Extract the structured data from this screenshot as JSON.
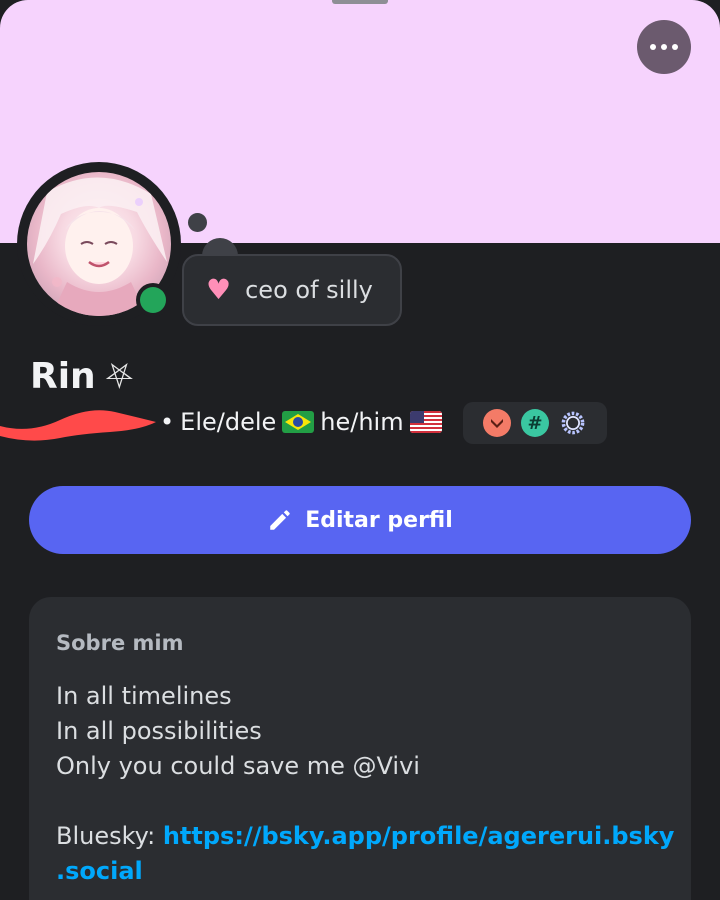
{
  "profile": {
    "display_name": "Rin",
    "name_symbol": "⛧",
    "pronouns_separator": "•",
    "pronouns_pt": "Ele/dele",
    "pronouns_en": "he/him"
  },
  "status": {
    "emoji": "♥",
    "text": "ceo of silly",
    "online_indicator": "online"
  },
  "badges": [
    "hypesquad-icon",
    "hashtag-icon",
    "wreath-icon"
  ],
  "actions": {
    "edit_profile_label": "Editar perfil"
  },
  "about": {
    "heading": "Sobre mim",
    "lines": [
      "In all timelines",
      "In all possibilities",
      "Only you could save me @Vivi"
    ],
    "bluesky_label": "Bluesky:",
    "bluesky_link": "https://bsky.app/profile/agererui.bsky.social"
  },
  "colors": {
    "banner": "#f6d3fd",
    "background": "#1e1f22",
    "card": "#2b2d31",
    "accent": "#5865f2",
    "online": "#23a55a",
    "link": "#00a8fc"
  }
}
